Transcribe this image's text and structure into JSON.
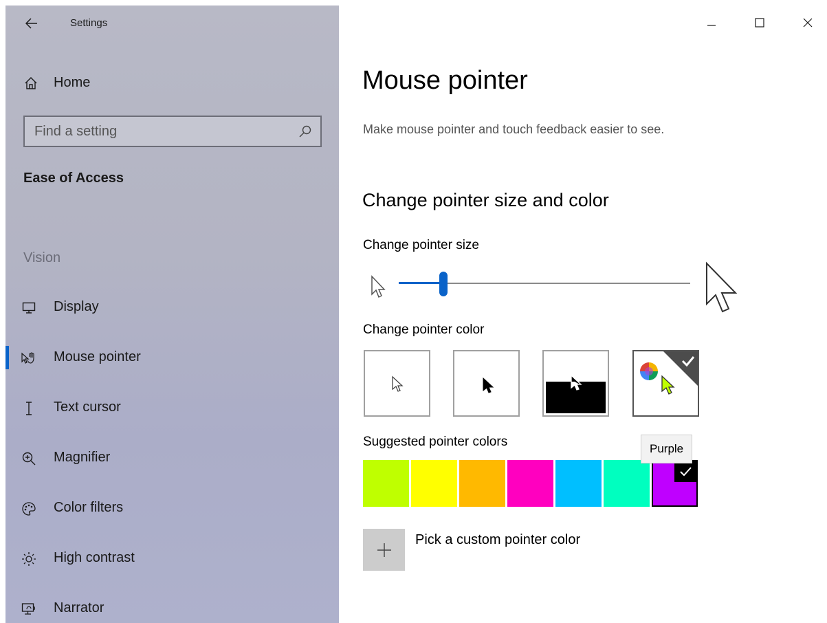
{
  "window": {
    "app_title": "Settings",
    "controls": [
      "minimize",
      "maximize",
      "close"
    ]
  },
  "sidebar": {
    "home_label": "Home",
    "search": {
      "placeholder": "Find a setting",
      "value": ""
    },
    "section_title": "Ease of Access",
    "group_label": "Vision",
    "items": [
      {
        "label": "Display",
        "icon": "monitor-icon",
        "selected": false
      },
      {
        "label": "Mouse pointer",
        "icon": "mouse-pointer-icon",
        "selected": true
      },
      {
        "label": "Text cursor",
        "icon": "text-cursor-icon",
        "selected": false
      },
      {
        "label": "Magnifier",
        "icon": "magnifier-icon",
        "selected": false
      },
      {
        "label": "Color filters",
        "icon": "color-filters-icon",
        "selected": false
      },
      {
        "label": "High contrast",
        "icon": "high-contrast-icon",
        "selected": false
      },
      {
        "label": "Narrator",
        "icon": "narrator-icon",
        "selected": false
      }
    ],
    "accent_color": "#0a63c9"
  },
  "main": {
    "title": "Mouse pointer",
    "description": "Make mouse pointer and touch feedback easier to see.",
    "section_heading": "Change pointer size and color",
    "size_label": "Change pointer size",
    "size_slider": {
      "min": 1,
      "max": 15,
      "value": 3
    },
    "color_label": "Change pointer color",
    "color_options": [
      {
        "id": "white",
        "selected": false
      },
      {
        "id": "black",
        "selected": false
      },
      {
        "id": "inverted",
        "selected": false
      },
      {
        "id": "custom",
        "selected": true
      }
    ],
    "suggested_label": "Suggested pointer colors",
    "suggested_colors": [
      {
        "hex": "#bfff00",
        "selected": false
      },
      {
        "hex": "#ffff00",
        "selected": false
      },
      {
        "hex": "#ffb900",
        "selected": false
      },
      {
        "hex": "#ff00bf",
        "selected": false
      },
      {
        "hex": "#00bfff",
        "selected": false
      },
      {
        "hex": "#00ffbf",
        "selected": false
      },
      {
        "hex": "#bf00ff",
        "selected": true
      }
    ],
    "tooltip": "Purple",
    "custom_color_label": "Pick a custom pointer color"
  }
}
